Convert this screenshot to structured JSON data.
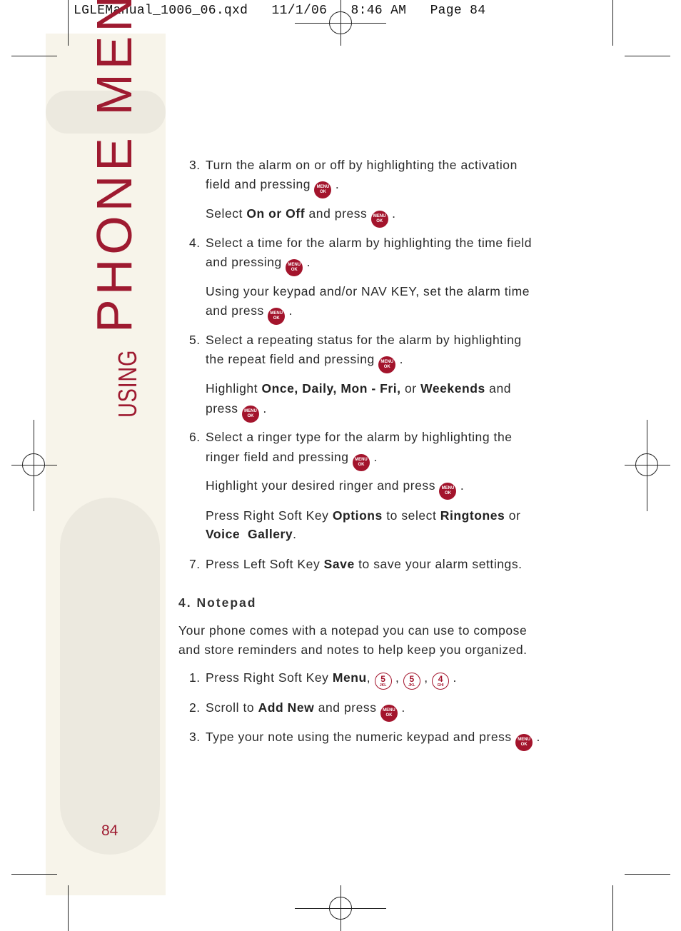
{
  "header": "LGLEManual_1006_06.qxd   11/1/06   8:46 AM   Page 84",
  "sidebar": {
    "using": "USING",
    "title": "PHONE MENUS",
    "accent": "#9e1a30"
  },
  "page_number": "84",
  "icons": {
    "menu_ok": {
      "top": "MENU",
      "bottom": "OK"
    }
  },
  "lines": [
    {
      "num": "3.",
      "segs": [
        {
          "t": "Turn the alarm on or off by highlighting the activation"
        }
      ]
    },
    {
      "segs": [
        {
          "t": "field and pressing "
        },
        {
          "icon": "menu_ok"
        },
        {
          "t": " ."
        }
      ]
    },
    {
      "segs": [
        {
          "t": "Select "
        },
        {
          "b": "On or Off"
        },
        {
          "t": " and press "
        },
        {
          "icon": "menu_ok"
        },
        {
          "t": " ."
        }
      ]
    },
    {
      "num": "4.",
      "segs": [
        {
          "t": "Select a time for the alarm by highlighting the time field"
        }
      ]
    },
    {
      "segs": [
        {
          "t": "and pressing "
        },
        {
          "icon": "menu_ok"
        },
        {
          "t": " ."
        }
      ]
    },
    {
      "segs": [
        {
          "t": "Using your keypad and/or NAV KEY, set the alarm time"
        }
      ]
    },
    {
      "segs": [
        {
          "t": "and press "
        },
        {
          "icon": "menu_ok"
        },
        {
          "t": " ."
        }
      ]
    },
    {
      "num": "5.",
      "segs": [
        {
          "t": "Select a repeating status for the alarm by highlighting"
        }
      ]
    },
    {
      "segs": [
        {
          "t": "the repeat field and pressing "
        },
        {
          "icon": "menu_ok"
        },
        {
          "t": " ."
        }
      ]
    },
    {
      "segs": [
        {
          "t": "Highlight "
        },
        {
          "b": "Once, Daily, Mon - Fri,"
        },
        {
          "t": " or "
        },
        {
          "b": "Weekends"
        },
        {
          "t": " and"
        }
      ]
    },
    {
      "segs": [
        {
          "t": "press "
        },
        {
          "icon": "menu_ok"
        },
        {
          "t": " ."
        }
      ]
    },
    {
      "num": "6.",
      "segs": [
        {
          "t": "Select a ringer type for the alarm by highlighting the"
        }
      ]
    },
    {
      "segs": [
        {
          "t": "ringer field and pressing "
        },
        {
          "icon": "menu_ok"
        },
        {
          "t": " ."
        }
      ]
    },
    {
      "segs": [
        {
          "t": "Highlight your desired ringer and press "
        },
        {
          "icon": "menu_ok"
        },
        {
          "t": " ."
        }
      ]
    },
    {
      "segs": [
        {
          "t": "Press Right Soft Key "
        },
        {
          "b": "Options"
        },
        {
          "t": " to select "
        },
        {
          "b": "Ringtones"
        },
        {
          "t": " or"
        }
      ]
    },
    {
      "segs": [
        {
          "b": "Voice  Gallery"
        },
        {
          "t": "."
        }
      ]
    },
    {
      "num": "7.",
      "segs": [
        {
          "t": "Press Left Soft Key "
        },
        {
          "b": "Save"
        },
        {
          "t": " to save your alarm settings."
        }
      ]
    },
    {
      "heading": "4. Notepad"
    },
    {
      "para": true,
      "segs": [
        {
          "t": "Your phone comes with a notepad you can use to compose"
        }
      ]
    },
    {
      "para": true,
      "segs": [
        {
          "t": "and store reminders and notes to help keep you organized."
        }
      ]
    },
    {
      "num": "1.",
      "segs": [
        {
          "t": "Press Right Soft Key "
        },
        {
          "b": "Menu"
        },
        {
          "t": ", "
        },
        {
          "key": "5",
          "sub": "JKL"
        },
        {
          "t": " , "
        },
        {
          "key": "5",
          "sub": "JKL"
        },
        {
          "t": " , "
        },
        {
          "key": "4",
          "sub": "GHI"
        },
        {
          "t": " ."
        }
      ]
    },
    {
      "num": "2.",
      "segs": [
        {
          "t": "Scroll to "
        },
        {
          "b": "Add New"
        },
        {
          "t": " and press "
        },
        {
          "icon": "menu_ok"
        },
        {
          "t": " ."
        }
      ]
    },
    {
      "num": "3.",
      "segs": [
        {
          "t": "Type your note using the numeric keypad and press "
        },
        {
          "icon": "menu_ok"
        },
        {
          "t": " ."
        }
      ]
    }
  ]
}
